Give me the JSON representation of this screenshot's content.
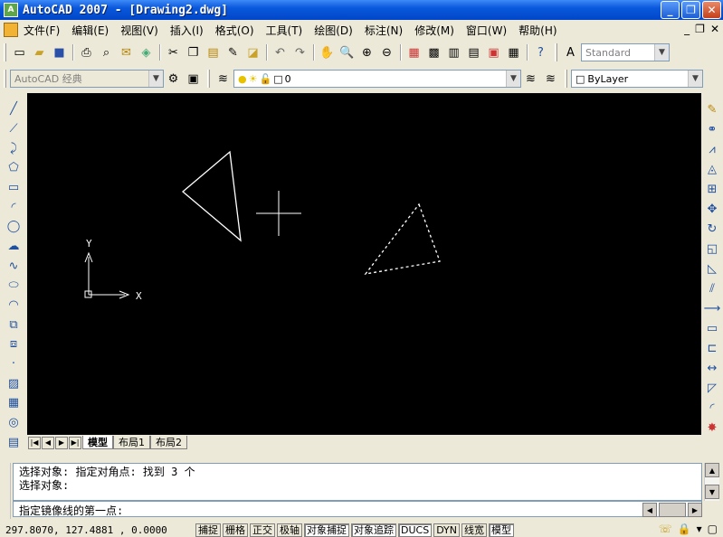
{
  "window": {
    "title": "AutoCAD 2007 - [Drawing2.dwg]",
    "app_icon": "autocad-logo-icon"
  },
  "window_buttons": {
    "minimize": "_",
    "restore": "❐",
    "close": "✕"
  },
  "menubar": {
    "items": [
      "文件(F)",
      "编辑(E)",
      "视图(V)",
      "插入(I)",
      "格式(O)",
      "工具(T)",
      "绘图(D)",
      "标注(N)",
      "修改(M)",
      "窗口(W)",
      "帮助(H)"
    ],
    "mdi_buttons": [
      "_",
      "❐",
      "✕"
    ]
  },
  "toolbar_standard": {
    "icons": [
      "new-icon",
      "open-icon",
      "save-icon",
      "plot-icon",
      "plot-preview-icon",
      "publish-icon",
      "3d-dwf-icon",
      "cut-icon",
      "copy-icon",
      "paste-icon",
      "match-properties-icon",
      "block-editor-icon",
      "undo-icon",
      "redo-icon",
      "pan-icon",
      "zoom-realtime-icon",
      "zoom-window-icon",
      "zoom-previous-icon",
      "properties-icon",
      "design-center-icon",
      "tool-palettes-icon",
      "sheet-set-icon",
      "markup-icon",
      "quickcalc-icon",
      "help-icon"
    ],
    "text_style_icon": "text-style-icon",
    "text_style": "Standard"
  },
  "toolbar_workspace": {
    "workspace": "AutoCAD 经典",
    "layer_value": "0",
    "color": "ByLayer"
  },
  "draw_toolbar": [
    "line",
    "construction-line",
    "polyline",
    "polygon",
    "rectangle",
    "arc",
    "circle",
    "revision-cloud",
    "spline",
    "ellipse",
    "ellipse-arc",
    "insert-block",
    "make-block",
    "point",
    "hatch",
    "gradient",
    "region"
  ],
  "modify_toolbar": [
    "erase",
    "copy",
    "mirror",
    "offset",
    "array",
    "move",
    "rotate",
    "scale",
    "stretch",
    "trim",
    "extend",
    "break-at-point",
    "break",
    "join",
    "chamfer",
    "fillet",
    "explode"
  ],
  "layout_tabs": {
    "nav": [
      "|◀",
      "◀",
      "▶",
      "▶|"
    ],
    "tabs": [
      "模型",
      "布局1",
      "布局2"
    ],
    "active": "模型"
  },
  "ucs": {
    "x_label": "X",
    "y_label": "Y"
  },
  "command": {
    "history": [
      "选择对象: 指定对角点: 找到 3 个",
      "选择对象:"
    ],
    "prompt": "指定镜像线的第一点:"
  },
  "status": {
    "coords": "297.8070, 127.4881 , 0.0000",
    "toggles": [
      {
        "label": "捕捉",
        "on": false
      },
      {
        "label": "栅格",
        "on": false
      },
      {
        "label": "正交",
        "on": false
      },
      {
        "label": "极轴",
        "on": false
      },
      {
        "label": "对象捕捉",
        "on": true
      },
      {
        "label": "对象追踪",
        "on": true
      },
      {
        "label": "DUCS",
        "on": true
      },
      {
        "label": "DYN",
        "on": false
      },
      {
        "label": "线宽",
        "on": false
      },
      {
        "label": "模型",
        "on": true
      }
    ]
  },
  "colors": {
    "canvas": "#000000",
    "title_bar": "#0a58dc",
    "geometry": "#ffffff"
  }
}
